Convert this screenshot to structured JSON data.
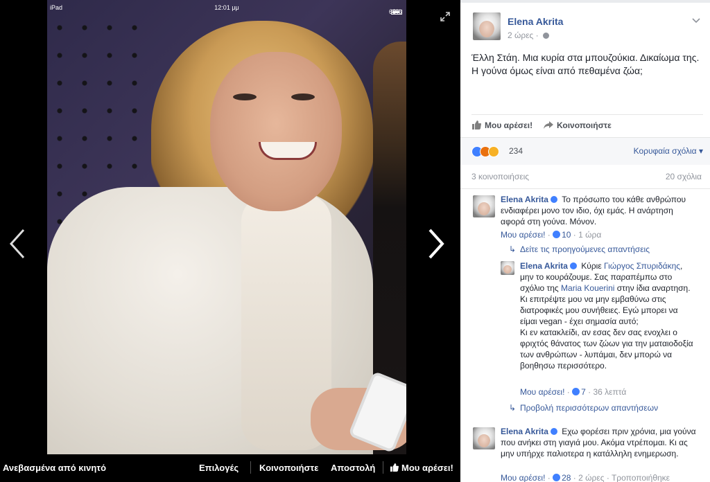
{
  "ios_status": {
    "device": "iPad",
    "time": "12:01 μμ",
    "battery": "68%"
  },
  "viewer": {
    "uploaded_label": "Ανεβασμένα από κινητό",
    "options": "Επιλογές",
    "share": "Κοινοποιήστε",
    "send": "Αποστολή",
    "like": "Μου αρέσει!"
  },
  "post": {
    "author": "Elena Akrita",
    "time": "2 ώρες",
    "text": "Έλλη Στάη. Μια κυρία στα μπουζούκια. Δικαίωμα της. Η γούνα όμως είναι από πεθαμένα ζώα;",
    "action_like": "Μου αρέσει!",
    "action_share": "Κοινοποιήστε",
    "reaction_count": "234",
    "sort_label": "Κορυφαία σχόλια",
    "shares": "3 κοινοποιήσεις",
    "comments": "20 σχόλια"
  },
  "comments": [
    {
      "author": "Elena Akrita",
      "text": "Το πρόσωπο του κάθε ανθρώπου ενδιαφέρει μονο τον ιδιο, όχι εμάς. Η ανάρτηση αφορά στη γούνα. Μόνον.",
      "like_label": "Μου αρέσει!",
      "likes": "10",
      "time": "1 ώρα"
    },
    {
      "author": "Elena Akrita",
      "text": "Εχω φορέσει πριν χρόνια, μια γούνα που ανήκει στη γιαγιά μου. Ακόμα ντρέπομαι. Κι ας μην υπήρχε παλιοτερα η κατάλληλη ενημερωση.",
      "like_label": "Μου αρέσει!",
      "likes": "28",
      "time": "2 ώρες",
      "extra": "Τροποποιήθηκε"
    }
  ],
  "previous_replies": "Δείτε τις προηγούμενες απαντήσεις",
  "reply": {
    "author": "Elena Akrita",
    "prefix": "Κύριε",
    "mention1": "Γιώργος Σπυριδάκης",
    "text1": ", μην το κουράζουμε. Σας παραπέμπω στο σχόλιο της",
    "mention2": "Maria Kouerini",
    "text2": "στην ίδια αναρτηση. Κι επιτρέψτε μου να μην εμβαθύνω στις διατροφικές μου συνήθειες. Εγώ μπορει να είμαι vegan - έχει σημασία αυτό;",
    "text3": "Κι εν κατακλείδι, αν εσας δεν σας ενοχλει ο φριχτός θάνατος των ζώων για την ματαιοδοξία των ανθρώπων - λυπάμαι, δεν μπορώ να βοηθησω περισσότερο.",
    "like_label": "Μου αρέσει!",
    "likes": "7",
    "time": "36 λεπτά"
  },
  "more_replies": "Προβολή περισσότερων απαντήσεων",
  "icons": {
    "prev": "chevron-left-icon",
    "next": "chevron-right-icon",
    "expand": "expand-icon",
    "like": "thumbs-up-icon",
    "share": "share-arrow-icon",
    "globe": "globe-icon",
    "menu": "chevron-down-icon"
  },
  "colors": {
    "link": "#365899",
    "meta": "#90949c",
    "like_blue": "#4080ff"
  }
}
